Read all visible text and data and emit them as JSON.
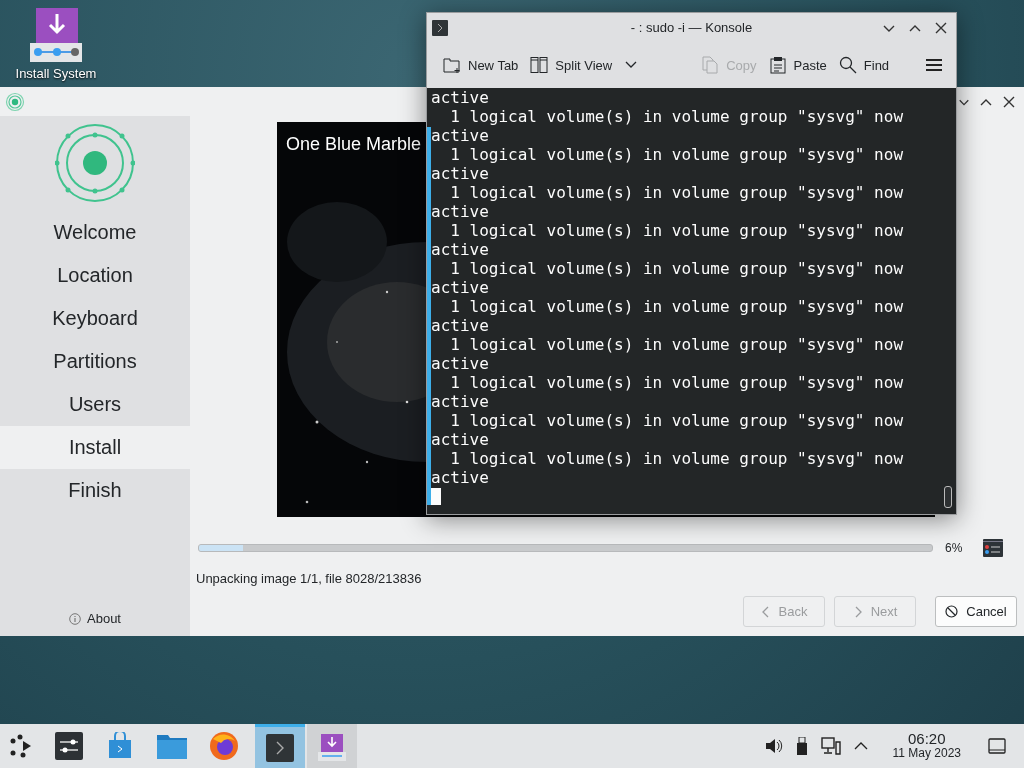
{
  "desktop": {
    "icon_label": "Install System"
  },
  "installer": {
    "sidebar": {
      "items": [
        {
          "label": "Welcome",
          "selected": false
        },
        {
          "label": "Location",
          "selected": false
        },
        {
          "label": "Keyboard",
          "selected": false
        },
        {
          "label": "Partitions",
          "selected": false
        },
        {
          "label": "Users",
          "selected": false
        },
        {
          "label": "Install",
          "selected": true
        },
        {
          "label": "Finish",
          "selected": false
        }
      ],
      "about": "About"
    },
    "slideshow": {
      "caption": "One Blue Marble"
    },
    "progress": {
      "level": 0.06,
      "percent": "6%"
    },
    "status": "Unpacking image 1/1, file 8028/213836",
    "buttons": [
      {
        "kind": "back",
        "label": "Back",
        "disabled": true
      },
      {
        "kind": "next",
        "label": "Next",
        "disabled": true
      },
      {
        "kind": "cancel",
        "label": "Cancel",
        "disabled": false
      }
    ]
  },
  "konsole": {
    "title": "- : sudo -i — Konsole",
    "toolbar": [
      {
        "kind": "new-tab",
        "label": "New Tab",
        "disabled": false
      },
      {
        "kind": "split-view",
        "label": "Split View",
        "disabled": false
      },
      {
        "kind": "copy",
        "label": "Copy",
        "disabled": true
      },
      {
        "kind": "paste",
        "label": "Paste",
        "disabled": false
      },
      {
        "kind": "find",
        "label": "Find",
        "disabled": false
      }
    ],
    "lines": [
      "active",
      "  1 logical volume(s) in volume group \"sysvg\" now",
      "active",
      "  1 logical volume(s) in volume group \"sysvg\" now",
      "active",
      "  1 logical volume(s) in volume group \"sysvg\" now",
      "active",
      "  1 logical volume(s) in volume group \"sysvg\" now",
      "active",
      "  1 logical volume(s) in volume group \"sysvg\" now",
      "active",
      "  1 logical volume(s) in volume group \"sysvg\" now",
      "active",
      "  1 logical volume(s) in volume group \"sysvg\" now",
      "active",
      "  1 logical volume(s) in volume group \"sysvg\" now",
      "active",
      "  1 logical volume(s) in volume group \"sysvg\" now",
      "active",
      "  1 logical volume(s) in volume group \"sysvg\" now",
      "active"
    ]
  },
  "taskbar": {
    "tasks": [
      {
        "kind": "terminal",
        "selected": true
      },
      {
        "kind": "installer",
        "selected": false
      }
    ],
    "clock": {
      "time": "06:20",
      "date": "11 May 2023"
    }
  }
}
